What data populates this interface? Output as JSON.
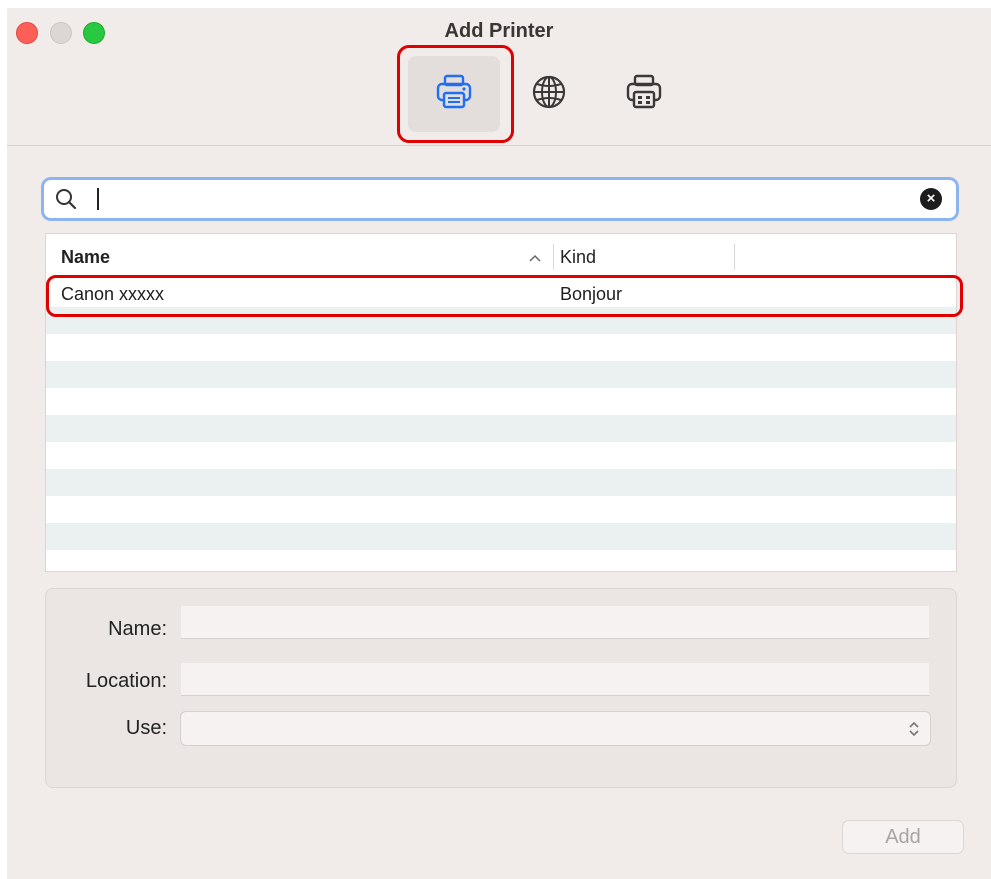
{
  "window": {
    "title": "Add Printer"
  },
  "toolbar": {
    "buttons": [
      {
        "icon": "default-printer-icon",
        "selected": true
      },
      {
        "icon": "ip-globe-icon",
        "selected": false
      },
      {
        "icon": "windows-printer-icon",
        "selected": false
      }
    ]
  },
  "search": {
    "value": "",
    "placeholder": ""
  },
  "table": {
    "columns": [
      "Name",
      "Kind"
    ],
    "sort": "ascending",
    "rows": [
      {
        "name": "Canon xxxxx",
        "kind": "Bonjour"
      }
    ]
  },
  "form": {
    "name_label": "Name:",
    "location_label": "Location:",
    "use_label": "Use:",
    "name_value": "",
    "location_value": "",
    "use_value": ""
  },
  "footer": {
    "add_label": "Add"
  },
  "colors": {
    "highlight": "#e00000",
    "accent": "#1f6ff2",
    "window_bg": "#f1ebea"
  }
}
